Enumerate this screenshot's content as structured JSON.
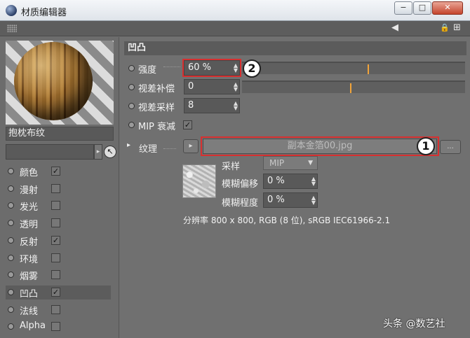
{
  "window": {
    "title": "材质编辑器",
    "min": "−",
    "max": "□",
    "close": "✕"
  },
  "toolbar": {
    "arrow_icon": "◀",
    "lock_icon": "🔒",
    "add_icon": "⊞"
  },
  "material": {
    "name": "抱枕布纹",
    "channels": [
      {
        "label": "颜色",
        "checked": true
      },
      {
        "label": "漫射",
        "checked": false
      },
      {
        "label": "发光",
        "checked": false
      },
      {
        "label": "透明",
        "checked": false
      },
      {
        "label": "反射",
        "checked": true
      },
      {
        "label": "环境",
        "checked": false
      },
      {
        "label": "烟雾",
        "checked": false
      },
      {
        "label": "凹凸",
        "checked": true,
        "active": true
      },
      {
        "label": "法线",
        "checked": false
      },
      {
        "label": "Alpha",
        "checked": false
      }
    ]
  },
  "bump": {
    "section_title": "凹凸",
    "strength": {
      "label": "强度",
      "value": "60 %",
      "slider_fraction": 0.6
    },
    "parallax_offset": {
      "label": "视差补偿",
      "value": "0",
      "slider_fraction": 0.5
    },
    "parallax_samples": {
      "label": "视差采样",
      "value": "8"
    },
    "mip_falloff": {
      "label": "MIP 衰减",
      "checked": true
    },
    "texture": {
      "label": "纹理",
      "file": "副本金箔00.jpg",
      "browse": "...",
      "sampling_label": "采样",
      "sampling_value": "MIP",
      "blur_offset_label": "模糊偏移",
      "blur_offset_value": "0 %",
      "blur_scale_label": "模糊程度",
      "blur_scale_value": "0 %",
      "resolution": "分辨率 800 x 800, RGB (8 位), sRGB IEC61966-2.1"
    }
  },
  "callouts": {
    "one": "1",
    "two": "2"
  },
  "watermark": "头条 @数艺社",
  "glyphs": {
    "check": "✓",
    "spin": "▲▼",
    "caret": "▼",
    "arrow_right": "▸",
    "pick": "↖"
  }
}
